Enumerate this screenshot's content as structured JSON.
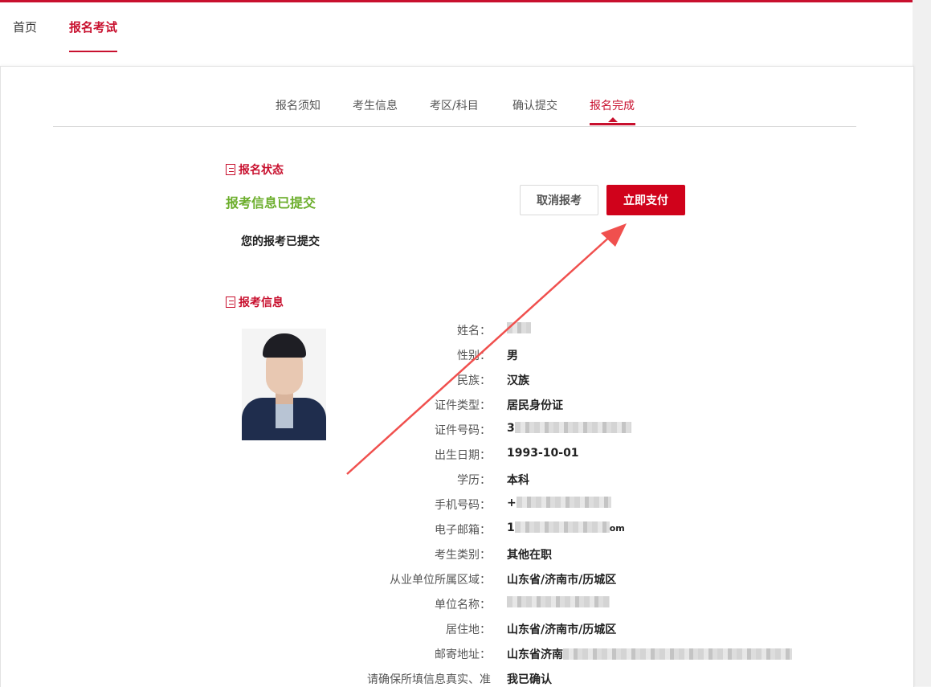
{
  "nav": {
    "items": [
      {
        "label": "首页"
      },
      {
        "label": "报名考试"
      }
    ]
  },
  "steps": [
    {
      "label": "报名须知"
    },
    {
      "label": "考生信息"
    },
    {
      "label": "考区/科目"
    },
    {
      "label": "确认提交"
    },
    {
      "label": "报名完成"
    }
  ],
  "status_section": {
    "title": "报名状态",
    "status": "报考信息已提交",
    "message": "您的报考已提交",
    "cancel_label": "取消报考",
    "pay_label": "立即支付"
  },
  "info_section": {
    "title": "报考信息",
    "fields": [
      {
        "label": "姓名：",
        "value": ""
      },
      {
        "label": "性别：",
        "value": "男"
      },
      {
        "label": "民族：",
        "value": "汉族"
      },
      {
        "label": "证件类型：",
        "value": "居民身份证"
      },
      {
        "label": "证件号码：",
        "value": "3"
      },
      {
        "label": "出生日期：",
        "value": "1993-10-01"
      },
      {
        "label": "学历：",
        "value": "本科"
      },
      {
        "label": "手机号码：",
        "value": "+"
      },
      {
        "label": "电子邮箱：",
        "value": "1"
      },
      {
        "label": "考生类别：",
        "value": "其他在职"
      },
      {
        "label": "从业单位所属区域：",
        "value": "山东省/济南市/历城区"
      },
      {
        "label": "单位名称：",
        "value": ""
      },
      {
        "label": "居住地：",
        "value": "山东省/济南市/历城区"
      },
      {
        "label": "邮寄地址：",
        "value": "山东省济南"
      },
      {
        "label": "请确保所填信息真实、准",
        "value": "我已确认"
      }
    ]
  },
  "colors": {
    "brand": "#c8102e",
    "success": "#6cae2c",
    "annotation_arrow": "#f0504e"
  },
  "icons": [
    "section-doc-icon",
    "step-caret-icon"
  ]
}
